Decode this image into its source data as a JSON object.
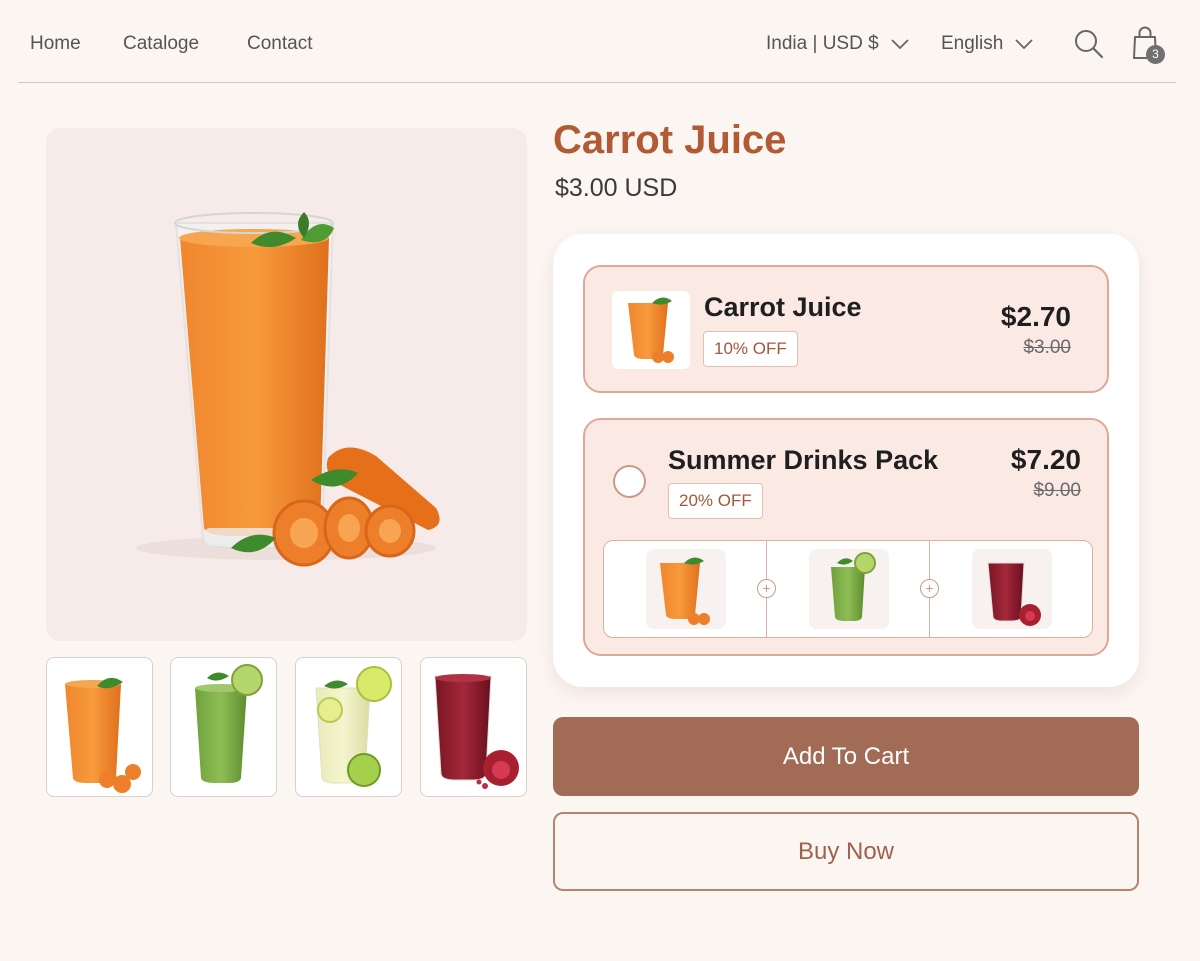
{
  "nav": {
    "links": [
      "Home",
      "Cataloge",
      "Contact"
    ],
    "country": "India | USD $",
    "language": "English",
    "cart_count": "3"
  },
  "product": {
    "title": "Carrot Juice",
    "price": "$3.00 USD"
  },
  "offers": [
    {
      "name": "Carrot Juice",
      "badge": "10% OFF",
      "price": "$2.70",
      "original_price": "$3.00"
    },
    {
      "name": "Summer Drinks Pack",
      "badge": "20% OFF",
      "price": "$7.20",
      "original_price": "$9.00"
    }
  ],
  "actions": {
    "add_to_cart": "Add To Cart",
    "buy_now": "Buy Now"
  },
  "colors": {
    "accent": "#b05b34",
    "button": "#a16b55",
    "offer_bg": "#fbe9e4",
    "offer_border": "#dea898"
  }
}
